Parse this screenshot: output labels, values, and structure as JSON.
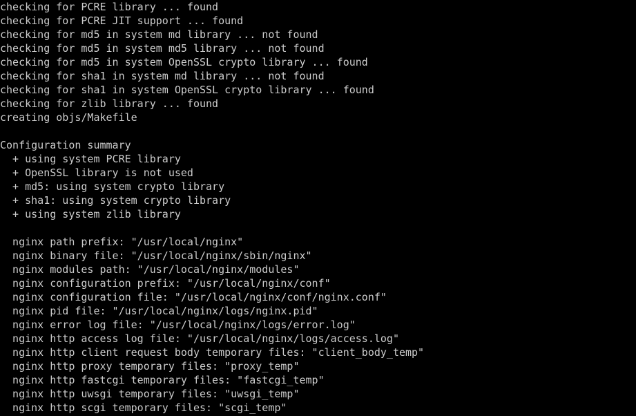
{
  "terminal": {
    "title": "nginx configure output",
    "background_color": "#000000",
    "foreground_color": "#cccccc",
    "font_size_px": 15,
    "line_height_px": 20,
    "columns": 91,
    "rows": 30,
    "lines": [
      "checking for PCRE library ... found",
      "checking for PCRE JIT support ... found",
      "checking for md5 in system md library ... not found",
      "checking for md5 in system md5 library ... not found",
      "checking for md5 in system OpenSSL crypto library ... found",
      "checking for sha1 in system md library ... not found",
      "checking for sha1 in system OpenSSL crypto library ... found",
      "checking for zlib library ... found",
      "creating objs/Makefile",
      "",
      "Configuration summary",
      "  + using system PCRE library",
      "  + OpenSSL library is not used",
      "  + md5: using system crypto library",
      "  + sha1: using system crypto library",
      "  + using system zlib library",
      "",
      "  nginx path prefix: \"/usr/local/nginx\"",
      "  nginx binary file: \"/usr/local/nginx/sbin/nginx\"",
      "  nginx modules path: \"/usr/local/nginx/modules\"",
      "  nginx configuration prefix: \"/usr/local/nginx/conf\"",
      "  nginx configuration file: \"/usr/local/nginx/conf/nginx.conf\"",
      "  nginx pid file: \"/usr/local/nginx/logs/nginx.pid\"",
      "  nginx error log file: \"/usr/local/nginx/logs/error.log\"",
      "  nginx http access log file: \"/usr/local/nginx/logs/access.log\"",
      "  nginx http client request body temporary files: \"client_body_temp\"",
      "  nginx http proxy temporary files: \"proxy_temp\"",
      "  nginx http fastcgi temporary files: \"fastcgi_temp\"",
      "  nginx http uwsgi temporary files: \"uwsgi_temp\"",
      "  nginx http scgi temporary files: \"scgi_temp\""
    ]
  }
}
